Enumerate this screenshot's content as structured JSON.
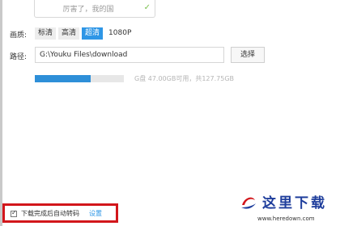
{
  "top_input": {
    "value": "厉害了，我的国",
    "check_icon": "check-icon"
  },
  "quality": {
    "label": "画质:",
    "options": [
      {
        "label": "标清",
        "selected": false
      },
      {
        "label": "高清",
        "selected": false
      },
      {
        "label": "超清",
        "selected": true
      },
      {
        "label": "1080P",
        "selected": false
      }
    ]
  },
  "path": {
    "label": "路径:",
    "value": "G:\\Youku Files\\download",
    "button_label": "选择"
  },
  "disk": {
    "used_fraction": 0.63,
    "text": "G盘 47.00GB可用，共127.75GB"
  },
  "auto_transcode": {
    "checked": true,
    "label": "下载完成后自动转码",
    "settings_link": "设置"
  },
  "watermark": {
    "title": "这里下载",
    "url": "www.heredown.com"
  },
  "colors": {
    "accent": "#2e96e6",
    "highlight_border": "#d2161b",
    "watermark_blue": "#1f3e9c",
    "watermark_red": "#d2161b"
  }
}
